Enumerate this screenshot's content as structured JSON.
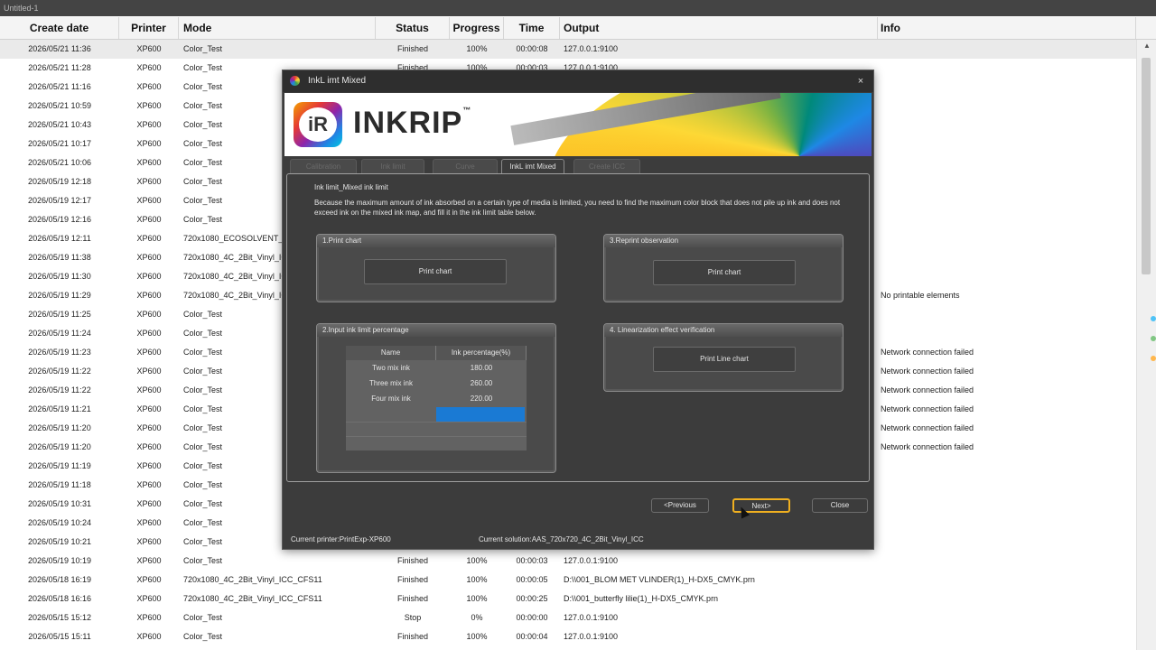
{
  "app": {
    "title": "Untitled-1"
  },
  "columns": [
    "Create date",
    "Printer",
    "Mode",
    "Status",
    "Progress",
    "Time",
    "Output",
    "Info"
  ],
  "rows": [
    {
      "date": "2026/05/21 11:36",
      "printer": "XP600",
      "mode": "Color_Test",
      "status": "Finished",
      "progress": "100%",
      "time": "00:00:08",
      "output": "127.0.0.1:9100",
      "info": ""
    },
    {
      "date": "2026/05/21 11:28",
      "printer": "XP600",
      "mode": "Color_Test",
      "status": "Finished",
      "progress": "100%",
      "time": "00:00:03",
      "output": "127.0.0.1:9100",
      "info": ""
    },
    {
      "date": "2026/05/21 11:16",
      "printer": "XP600",
      "mode": "Color_Test",
      "status": "",
      "progress": "",
      "time": "",
      "output": "",
      "info": ""
    },
    {
      "date": "2026/05/21 10:59",
      "printer": "XP600",
      "mode": "Color_Test",
      "status": "",
      "progress": "",
      "time": "",
      "output": "",
      "info": ""
    },
    {
      "date": "2026/05/21 10:43",
      "printer": "XP600",
      "mode": "Color_Test",
      "status": "",
      "progress": "",
      "time": "",
      "output": "",
      "info": ""
    },
    {
      "date": "2026/05/21 10:17",
      "printer": "XP600",
      "mode": "Color_Test",
      "status": "",
      "progress": "",
      "time": "",
      "output": "",
      "info": ""
    },
    {
      "date": "2026/05/21 10:06",
      "printer": "XP600",
      "mode": "Color_Test",
      "status": "",
      "progress": "",
      "time": "",
      "output": "",
      "info": ""
    },
    {
      "date": "2026/05/19 12:18",
      "printer": "XP600",
      "mode": "Color_Test",
      "status": "",
      "progress": "",
      "time": "",
      "output": "",
      "info": ""
    },
    {
      "date": "2026/05/19 12:17",
      "printer": "XP600",
      "mode": "Color_Test",
      "status": "",
      "progress": "",
      "time": "",
      "output": "",
      "info": ""
    },
    {
      "date": "2026/05/19 12:16",
      "printer": "XP600",
      "mode": "Color_Test",
      "status": "",
      "progress": "",
      "time": "",
      "output": "",
      "info": ""
    },
    {
      "date": "2026/05/19 12:11",
      "printer": "XP600",
      "mode": "720x1080_ECOSOLVENT_2",
      "status": "",
      "progress": "",
      "time": "",
      "output": "",
      "info": ""
    },
    {
      "date": "2026/05/19 11:38",
      "printer": "XP600",
      "mode": "720x1080_4C_2Bit_Vinyl_IC",
      "status": "",
      "progress": "",
      "time": "",
      "output": "",
      "info": ""
    },
    {
      "date": "2026/05/19 11:30",
      "printer": "XP600",
      "mode": "720x1080_4C_2Bit_Vinyl_IC",
      "status": "",
      "progress": "",
      "time": "",
      "output": "",
      "info": ""
    },
    {
      "date": "2026/05/19 11:29",
      "printer": "XP600",
      "mode": "720x1080_4C_2Bit_Vinyl_IC",
      "status": "",
      "progress": "",
      "time": "",
      "output": "",
      "info": "No printable elements"
    },
    {
      "date": "2026/05/19 11:25",
      "printer": "XP600",
      "mode": "Color_Test",
      "status": "",
      "progress": "",
      "time": "",
      "output": "",
      "info": ""
    },
    {
      "date": "2026/05/19 11:24",
      "printer": "XP600",
      "mode": "Color_Test",
      "status": "",
      "progress": "",
      "time": "",
      "output": "",
      "info": ""
    },
    {
      "date": "2026/05/19 11:23",
      "printer": "XP600",
      "mode": "Color_Test",
      "status": "",
      "progress": "",
      "time": "",
      "output": "",
      "info": "Network connection failed"
    },
    {
      "date": "2026/05/19 11:22",
      "printer": "XP600",
      "mode": "Color_Test",
      "status": "",
      "progress": "",
      "time": "",
      "output": "",
      "info": "Network connection failed"
    },
    {
      "date": "2026/05/19 11:22",
      "printer": "XP600",
      "mode": "Color_Test",
      "status": "",
      "progress": "",
      "time": "",
      "output": "",
      "info": "Network connection failed"
    },
    {
      "date": "2026/05/19 11:21",
      "printer": "XP600",
      "mode": "Color_Test",
      "status": "",
      "progress": "",
      "time": "",
      "output": "",
      "info": "Network connection failed"
    },
    {
      "date": "2026/05/19 11:20",
      "printer": "XP600",
      "mode": "Color_Test",
      "status": "",
      "progress": "",
      "time": "",
      "output": "",
      "info": "Network connection failed"
    },
    {
      "date": "2026/05/19 11:20",
      "printer": "XP600",
      "mode": "Color_Test",
      "status": "",
      "progress": "",
      "time": "",
      "output": "",
      "info": "Network connection failed"
    },
    {
      "date": "2026/05/19 11:19",
      "printer": "XP600",
      "mode": "Color_Test",
      "status": "",
      "progress": "",
      "time": "",
      "output": "",
      "info": ""
    },
    {
      "date": "2026/05/19 11:18",
      "printer": "XP600",
      "mode": "Color_Test",
      "status": "",
      "progress": "",
      "time": "",
      "output": "",
      "info": ""
    },
    {
      "date": "2026/05/19 10:31",
      "printer": "XP600",
      "mode": "Color_Test",
      "status": "",
      "progress": "",
      "time": "",
      "output": "",
      "info": ""
    },
    {
      "date": "2026/05/19 10:24",
      "printer": "XP600",
      "mode": "Color_Test",
      "status": "",
      "progress": "",
      "time": "",
      "output": "",
      "info": ""
    },
    {
      "date": "2026/05/19 10:21",
      "printer": "XP600",
      "mode": "Color_Test",
      "status": "",
      "progress": "",
      "time": "",
      "output": "",
      "info": ""
    },
    {
      "date": "2026/05/19 10:19",
      "printer": "XP600",
      "mode": "Color_Test",
      "status": "Finished",
      "progress": "100%",
      "time": "00:00:03",
      "output": "127.0.0.1:9100",
      "info": ""
    },
    {
      "date": "2026/05/18 16:19",
      "printer": "XP600",
      "mode": "720x1080_4C_2Bit_Vinyl_ICC_CFS11",
      "status": "Finished",
      "progress": "100%",
      "time": "00:00:05",
      "output": "D:\\\\001_BLOM MET VLINDER(1)_H-DX5_CMYK.prn",
      "info": ""
    },
    {
      "date": "2026/05/18 16:16",
      "printer": "XP600",
      "mode": "720x1080_4C_2Bit_Vinyl_ICC_CFS11",
      "status": "Finished",
      "progress": "100%",
      "time": "00:00:25",
      "output": "D:\\\\001_butterfly lilie(1)_H-DX5_CMYK.prn",
      "info": ""
    },
    {
      "date": "2026/05/15 15:12",
      "printer": "XP600",
      "mode": "Color_Test",
      "status": "Stop",
      "progress": "0%",
      "time": "00:00:00",
      "output": "127.0.0.1:9100",
      "info": ""
    },
    {
      "date": "2026/05/15 15:11",
      "printer": "XP600",
      "mode": "Color_Test",
      "status": "Finished",
      "progress": "100%",
      "time": "00:00:04",
      "output": "127.0.0.1:9100",
      "info": ""
    }
  ],
  "dialog": {
    "title": "InkL imt Mixed",
    "close_glyph": "×",
    "brand": {
      "mark": "iR",
      "name": "INKRIP",
      "tm": "™"
    },
    "tabs": [
      "Calibration",
      "Ink limit",
      "Curve",
      "InkL imt Mixed",
      "Create ICC"
    ],
    "active_tab": 3,
    "heading": "Ink limit_Mixed ink limit",
    "description": "Because the maximum amount of ink absorbed on a certain type of media is limited, you need to find the maximum color block that does not pile up ink and does not exceed ink on the mixed ink map, and fill it in the ink limit table below.",
    "group1": {
      "title": "1.Print chart",
      "button": "Print chart"
    },
    "group2": {
      "title": "2.Input ink limit percentage",
      "columns": [
        "Name",
        "Ink percentage(%)"
      ],
      "rows": [
        [
          "Two mix ink",
          "180.00"
        ],
        [
          "Three mix ink",
          "260.00"
        ],
        [
          "Four mix ink",
          "220.00"
        ]
      ]
    },
    "group3": {
      "title": "3.Reprint observation",
      "button": "Print chart"
    },
    "group4": {
      "title": "4. Linearization effect verification",
      "button": "Print Line chart"
    },
    "buttons": {
      "previous": "<Previous",
      "next": "Next>",
      "close": "Close"
    },
    "status": {
      "printer": "Current printer:PrintExp-XP600",
      "solution": "Current solution:AAS_720x720_4C_2Bit_Vinyl_ICC"
    },
    "colors": {
      "selected_cell": "#1a7ad4",
      "next_border": "#f0b020"
    }
  }
}
